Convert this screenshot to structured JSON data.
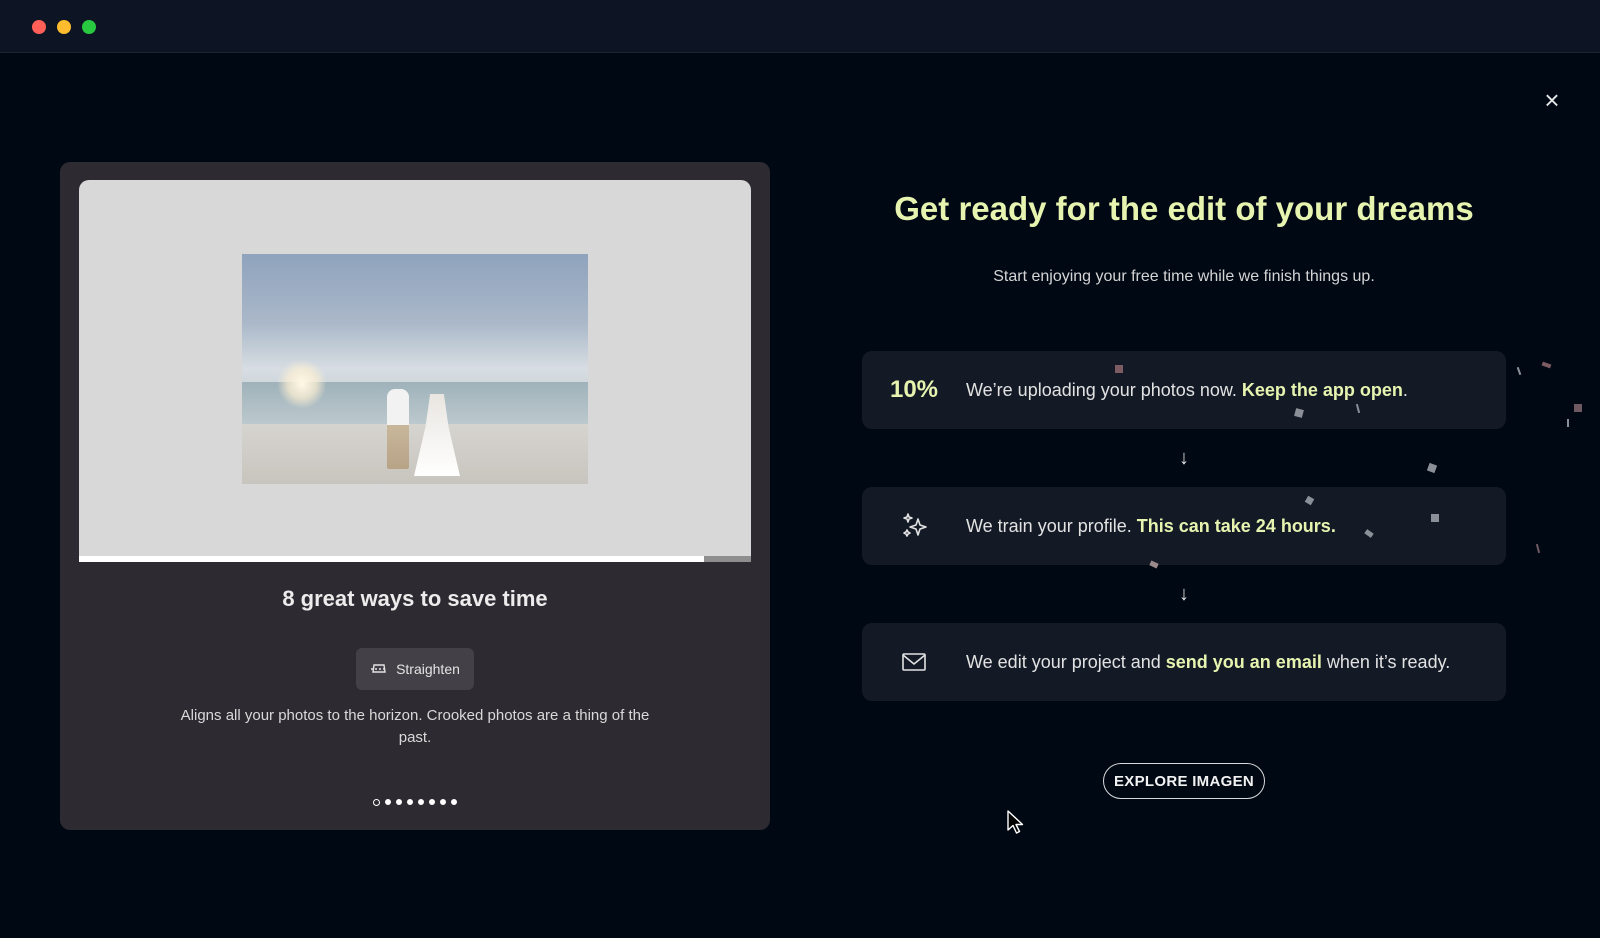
{
  "window": {
    "close_symbol": "×"
  },
  "slideshow": {
    "progress": 0.93,
    "title": "8 great ways to save time",
    "feature_chip": {
      "icon": "straighten-icon",
      "label": "Straighten"
    },
    "description": "Aligns all your photos to the horizon. Crooked photos are a thing of the past.",
    "dot_count": 8,
    "active_dot": 0
  },
  "onboarding": {
    "headline": "Get ready for the edit of your dreams",
    "subheadline": "Start enjoying your free time while we finish things up.",
    "steps": [
      {
        "lead": "10%",
        "text_before": "We’re uploading your photos now. ",
        "highlight": "Keep the app open",
        "text_after": "."
      },
      {
        "icon": "sparkles-icon",
        "text_before": "We train your profile. ",
        "highlight": "This can take 24 hours.",
        "text_after": ""
      },
      {
        "icon": "mail-icon",
        "text_before": "We edit your project and ",
        "highlight": "send you an email",
        "text_after": " when it’s ready."
      }
    ],
    "arrow_symbol": "↓",
    "explore_button": "EXPLORE IMAGEN"
  },
  "colors": {
    "background": "#000814",
    "accent": "#e7f4b0",
    "card": "#2e2a31",
    "step_card": "#131a26"
  }
}
